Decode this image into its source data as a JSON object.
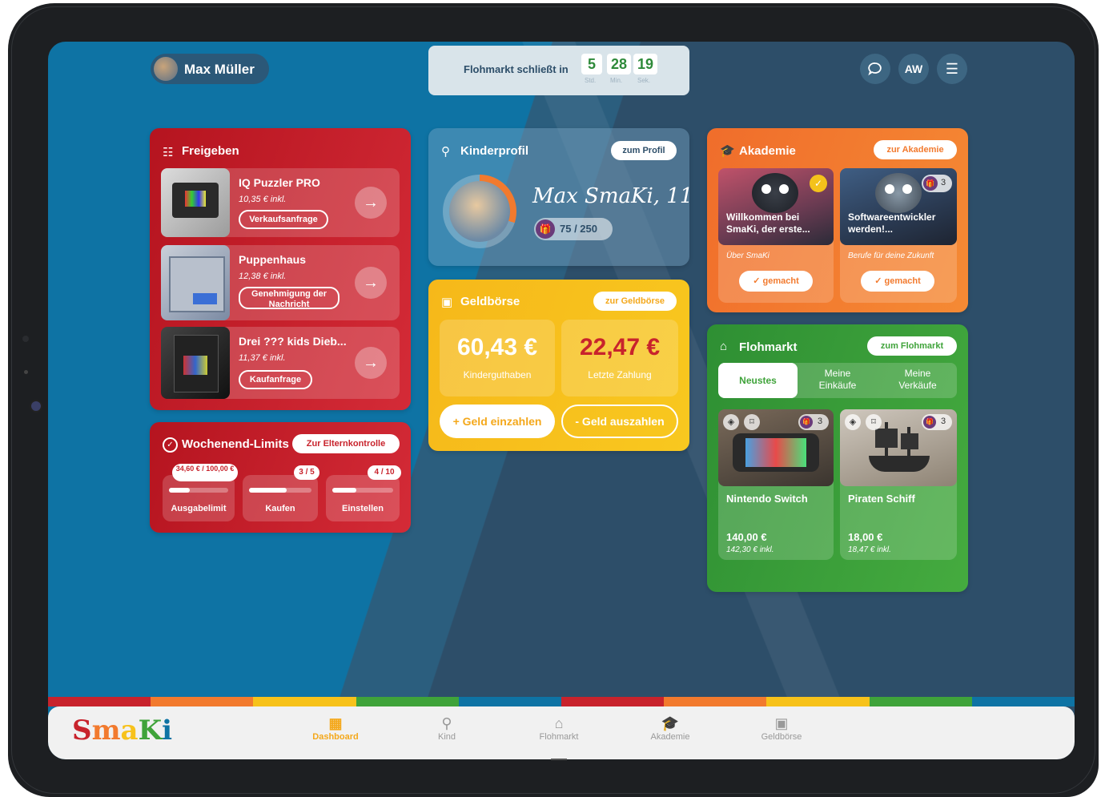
{
  "header": {
    "user_name": "Max Müller",
    "timer_label": "Flohmarkt schließt in",
    "timer": [
      {
        "value": "5",
        "unit": "Std."
      },
      {
        "value": "28",
        "unit": "Min."
      },
      {
        "value": "19",
        "unit": "Sek."
      }
    ],
    "avatar_initials": "AW"
  },
  "freigeben": {
    "title": "Freigeben",
    "items": [
      {
        "name": "IQ Puzzler PRO",
        "price": "10,35 € inkl.",
        "tag": "Verkaufsanfrage"
      },
      {
        "name": "Puppenhaus",
        "price": "12,38 € inkl.",
        "tag": "Genehmigung der Nachricht"
      },
      {
        "name": "Drei ??? kids Dieb...",
        "price": "11,37 € inkl.",
        "tag": "Kaufanfrage"
      }
    ]
  },
  "limits": {
    "title": "Wochenend-Limits",
    "button": "Zur Elternkontrolle",
    "items": [
      {
        "label": "Ausgabelimit",
        "badge": "34,60 € / 100,00 €",
        "fill": 0.35
      },
      {
        "label": "Kaufen",
        "badge": "3 / 5",
        "fill": 0.6
      },
      {
        "label": "Einstellen",
        "badge": "4 / 10",
        "fill": 0.4
      }
    ]
  },
  "kinderprofil": {
    "title": "Kinderprofil",
    "button": "zum Profil",
    "name": "Max SmaKi, 11",
    "points": "75 / 250",
    "points_fill": 0.3
  },
  "geldboerse": {
    "title": "Geldbörse",
    "button": "zur Geldbörse",
    "balance": "60,43 €",
    "balance_label": "Kinderguthaben",
    "last": "22,47 €",
    "last_label": "Letzte Zahlung",
    "deposit": "+ Geld einzahlen",
    "withdraw": "- Geld auszahlen"
  },
  "akademie": {
    "title": "Akademie",
    "button": "zur Akademie",
    "courses": [
      {
        "title": "Willkommen bei SmaKi, der erste...",
        "category": "Über SmaKi",
        "status": "✓ gemacht"
      },
      {
        "title": "Softwareentwickler werden!...",
        "category": "Berufe für deine Zukunft",
        "status": "✓ gemacht",
        "badge": "3"
      }
    ]
  },
  "flohmarkt": {
    "title": "Flohmarkt",
    "button": "zum Flohmarkt",
    "tabs": [
      "Neustes",
      "Meine Einkäufe",
      "Meine Verkäufe"
    ],
    "items": [
      {
        "name": "Nintendo Switch",
        "price": "140,00 €",
        "price_incl": "142,30 € inkl.",
        "badge": "3"
      },
      {
        "name": "Piraten Schiff",
        "price": "18,00 €",
        "price_incl": "18,47 € inkl.",
        "badge": "3"
      }
    ]
  },
  "nav": {
    "logo": "SmaKi",
    "items": [
      "Dashboard",
      "Kind",
      "Flohmarkt",
      "Akademie",
      "Geldbörse"
    ]
  },
  "colors": {
    "red": "#c8232c",
    "yellow": "#f7c21b",
    "orange": "#f27a2e",
    "green": "#3fa33a",
    "blue_bg": "#0e73a4",
    "dark_bg": "#2d4e69"
  }
}
